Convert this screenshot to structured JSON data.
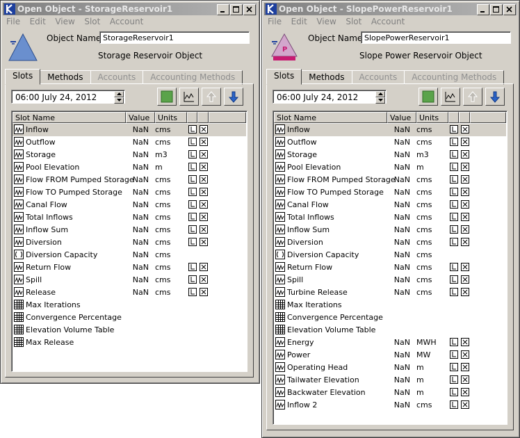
{
  "colors": {
    "titlebar": "#808080",
    "accent_blue": "#2a63c8",
    "green": "#5aa34a",
    "pink_base": "#c71a72"
  },
  "windows": [
    {
      "title": "Open Object - StorageReservoir1",
      "menu": [
        "File",
        "Edit",
        "View",
        "Slot",
        "Account"
      ],
      "object_name_label": "Object Name:",
      "object_name": "StorageReservoir1",
      "object_type": "Storage Reservoir Object",
      "icon": "storage-reservoir-icon",
      "tabs": [
        {
          "label": "Slots",
          "active": true,
          "enabled": true
        },
        {
          "label": "Methods",
          "active": false,
          "enabled": true
        },
        {
          "label": "Accounts",
          "active": false,
          "enabled": false
        },
        {
          "label": "Accounting Methods",
          "active": false,
          "enabled": false
        }
      ],
      "date": "06:00 July 24, 2012",
      "columns": [
        "Slot Name",
        "Value",
        "Units"
      ],
      "slots": [
        {
          "name": "Inflow",
          "value": "NaN",
          "units": "cms",
          "icon": "series-slot-icon",
          "flags": true,
          "selected": true
        },
        {
          "name": "Outflow",
          "value": "NaN",
          "units": "cms",
          "icon": "series-slot-icon",
          "flags": true
        },
        {
          "name": "Storage",
          "value": "NaN",
          "units": "m3",
          "icon": "series-slot-icon",
          "flags": true
        },
        {
          "name": "Pool Elevation",
          "value": "NaN",
          "units": "m",
          "icon": "series-slot-icon",
          "flags": true
        },
        {
          "name": "Flow FROM Pumped Storage",
          "value": "NaN",
          "units": "cms",
          "icon": "series-slot-icon",
          "flags": true
        },
        {
          "name": "Flow TO Pumped Storage",
          "value": "NaN",
          "units": "cms",
          "icon": "series-slot-icon",
          "flags": true
        },
        {
          "name": "Canal Flow",
          "value": "NaN",
          "units": "cms",
          "icon": "series-slot-icon",
          "flags": true
        },
        {
          "name": "Total Inflows",
          "value": "NaN",
          "units": "cms",
          "icon": "series-slot-icon",
          "flags": true
        },
        {
          "name": "Inflow Sum",
          "value": "NaN",
          "units": "cms",
          "icon": "series-slot-icon",
          "flags": true
        },
        {
          "name": "Diversion",
          "value": "NaN",
          "units": "cms",
          "icon": "series-slot-icon",
          "flags": true
        },
        {
          "name": "Diversion Capacity",
          "value": "NaN",
          "units": "cms",
          "icon": "agg-slot-icon",
          "flags": false
        },
        {
          "name": "Return Flow",
          "value": "NaN",
          "units": "cms",
          "icon": "series-slot-icon",
          "flags": true
        },
        {
          "name": "Spill",
          "value": "NaN",
          "units": "cms",
          "icon": "series-slot-icon",
          "flags": true
        },
        {
          "name": "Release",
          "value": "NaN",
          "units": "cms",
          "icon": "series-slot-icon",
          "flags": true
        },
        {
          "name": "Max Iterations",
          "value": "",
          "units": "",
          "icon": "table-slot-icon",
          "flags": false
        },
        {
          "name": "Convergence Percentage",
          "value": "",
          "units": "",
          "icon": "table-slot-icon",
          "flags": false
        },
        {
          "name": "Elevation Volume Table",
          "value": "",
          "units": "",
          "icon": "table-slot-icon",
          "flags": false
        },
        {
          "name": "Max Release",
          "value": "",
          "units": "",
          "icon": "table-slot-icon",
          "flags": false
        }
      ]
    },
    {
      "title": "Open Object - SlopePowerReservoir1",
      "menu": [
        "File",
        "Edit",
        "View",
        "Slot",
        "Account"
      ],
      "object_name_label": "Object Name:",
      "object_name": "SlopePowerReservoir1",
      "object_type": "Slope Power Reservoir Object",
      "icon": "slope-power-reservoir-icon",
      "tabs": [
        {
          "label": "Slots",
          "active": true,
          "enabled": true
        },
        {
          "label": "Methods",
          "active": false,
          "enabled": true
        },
        {
          "label": "Accounts",
          "active": false,
          "enabled": false
        },
        {
          "label": "Accounting Methods",
          "active": false,
          "enabled": false
        }
      ],
      "date": "06:00 July 24, 2012",
      "columns": [
        "Slot Name",
        "Value",
        "Units"
      ],
      "slots": [
        {
          "name": "Inflow",
          "value": "NaN",
          "units": "cms",
          "icon": "series-slot-icon",
          "flags": true,
          "selected": true
        },
        {
          "name": "Outflow",
          "value": "NaN",
          "units": "cms",
          "icon": "series-slot-icon",
          "flags": true
        },
        {
          "name": "Storage",
          "value": "NaN",
          "units": "m3",
          "icon": "series-slot-icon",
          "flags": true
        },
        {
          "name": "Pool Elevation",
          "value": "NaN",
          "units": "m",
          "icon": "series-slot-icon",
          "flags": true
        },
        {
          "name": "Flow FROM Pumped Storage",
          "value": "NaN",
          "units": "cms",
          "icon": "series-slot-icon",
          "flags": true
        },
        {
          "name": "Flow TO Pumped Storage",
          "value": "NaN",
          "units": "cms",
          "icon": "series-slot-icon",
          "flags": true
        },
        {
          "name": "Canal Flow",
          "value": "NaN",
          "units": "cms",
          "icon": "series-slot-icon",
          "flags": true
        },
        {
          "name": "Total Inflows",
          "value": "NaN",
          "units": "cms",
          "icon": "series-slot-icon",
          "flags": true
        },
        {
          "name": "Inflow Sum",
          "value": "NaN",
          "units": "cms",
          "icon": "series-slot-icon",
          "flags": true
        },
        {
          "name": "Diversion",
          "value": "NaN",
          "units": "cms",
          "icon": "series-slot-icon",
          "flags": true
        },
        {
          "name": "Diversion Capacity",
          "value": "NaN",
          "units": "cms",
          "icon": "agg-slot-icon",
          "flags": false
        },
        {
          "name": "Return Flow",
          "value": "NaN",
          "units": "cms",
          "icon": "series-slot-icon",
          "flags": true
        },
        {
          "name": "Spill",
          "value": "NaN",
          "units": "cms",
          "icon": "series-slot-icon",
          "flags": true
        },
        {
          "name": "Turbine Release",
          "value": "NaN",
          "units": "cms",
          "icon": "series-slot-icon",
          "flags": true
        },
        {
          "name": "Max Iterations",
          "value": "",
          "units": "",
          "icon": "table-slot-icon",
          "flags": false
        },
        {
          "name": "Convergence Percentage",
          "value": "",
          "units": "",
          "icon": "table-slot-icon",
          "flags": false
        },
        {
          "name": "Elevation Volume Table",
          "value": "",
          "units": "",
          "icon": "table-slot-icon",
          "flags": false
        },
        {
          "name": "Energy",
          "value": "NaN",
          "units": "MWH",
          "icon": "series-slot-icon",
          "flags": true
        },
        {
          "name": "Power",
          "value": "NaN",
          "units": "MW",
          "icon": "series-slot-icon",
          "flags": true
        },
        {
          "name": "Operating Head",
          "value": "NaN",
          "units": "m",
          "icon": "series-slot-icon",
          "flags": true
        },
        {
          "name": "Tailwater Elevation",
          "value": "NaN",
          "units": "m",
          "icon": "series-slot-icon",
          "flags": true
        },
        {
          "name": "Backwater Elevation",
          "value": "NaN",
          "units": "m",
          "icon": "series-slot-icon",
          "flags": true
        },
        {
          "name": "Inflow 2",
          "value": "NaN",
          "units": "cms",
          "icon": "series-slot-icon",
          "flags": true
        }
      ]
    }
  ]
}
